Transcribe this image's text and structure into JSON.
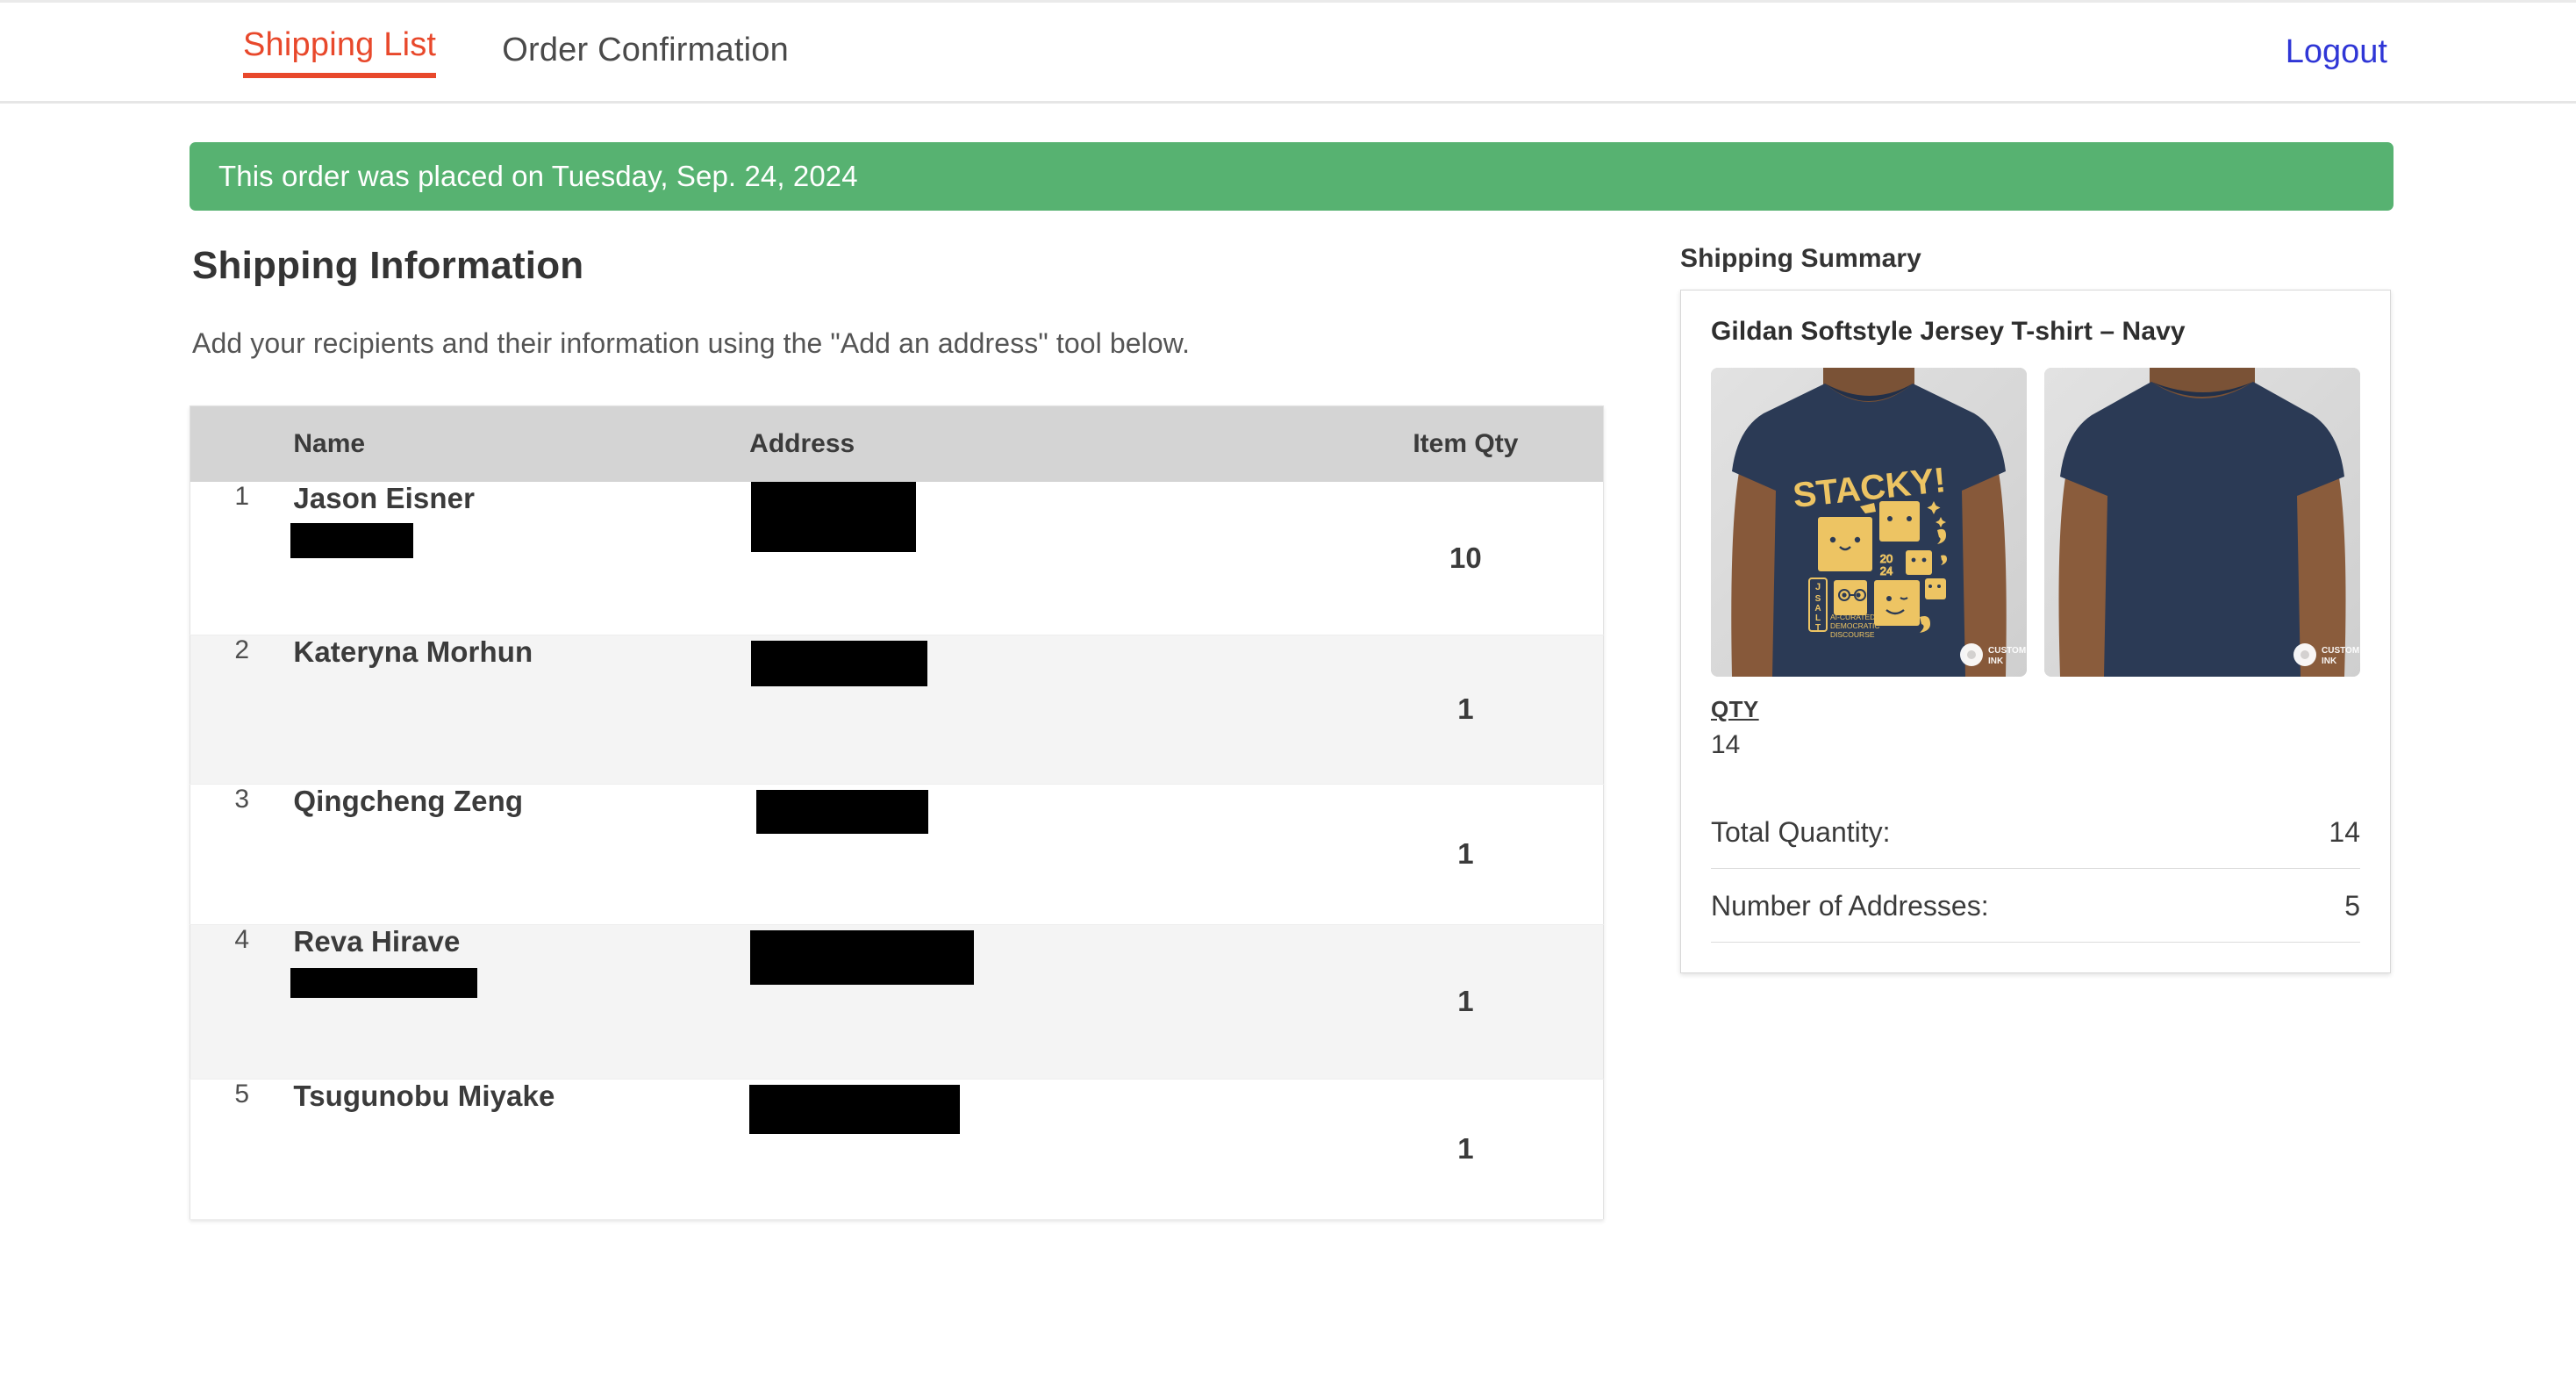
{
  "nav": {
    "tabs": [
      {
        "label": "Shipping List",
        "active": true
      },
      {
        "label": "Order Confirmation",
        "active": false
      }
    ],
    "logout_label": "Logout",
    "active_color": "#e8482b",
    "link_color": "#2f36d6"
  },
  "banner": {
    "text": "This order was placed on Tuesday, Sep. 24, 2024",
    "background_color": "#57b271",
    "text_color": "#ffffff"
  },
  "main": {
    "title": "Shipping Information",
    "subtitle": "Add your recipients and their information using the \"Add an address\" tool below.",
    "table": {
      "columns": [
        "",
        "Name",
        "Address",
        "Item Qty"
      ],
      "header_background": "#d4d4d4",
      "rows": [
        {
          "index": "1",
          "name": "Jason Eisner",
          "name_redacted": true,
          "address_redacted": true,
          "qty": "10"
        },
        {
          "index": "2",
          "name": "Kateryna Morhun",
          "name_redacted": false,
          "address_redacted": true,
          "qty": "1"
        },
        {
          "index": "3",
          "name": "Qingcheng Zeng",
          "name_redacted": false,
          "address_redacted": true,
          "qty": "1"
        },
        {
          "index": "4",
          "name": "Reva Hirave",
          "name_redacted": true,
          "address_redacted": true,
          "qty": "1"
        },
        {
          "index": "5",
          "name": "Tsugunobu Miyake",
          "name_redacted": false,
          "address_redacted": true,
          "qty": "1"
        }
      ]
    }
  },
  "summary": {
    "title": "Shipping Summary",
    "product_name": "Gildan Softstyle Jersey T-shirt – Navy",
    "images": [
      {
        "alt": "tshirt-front-navy-stacky-design",
        "view": "front"
      },
      {
        "alt": "tshirt-back-navy-plain",
        "view": "back"
      }
    ],
    "shirt_design": {
      "headline": "STACKY!",
      "year": "20 24",
      "brand_tag": "J SALT",
      "tagline_line1": "AI-CURATED",
      "tagline_line2": "DEMOCRATIC",
      "tagline_line3": "DISCOURSE",
      "shirt_color": "#2b3a55",
      "print_color": "#edc463",
      "watermark_line1": "CUSTOM",
      "watermark_line2": "INK"
    },
    "qty_label": "QTY",
    "qty_value": "14",
    "totals": [
      {
        "label": "Total Quantity:",
        "value": "14"
      },
      {
        "label": "Number of Addresses:",
        "value": "5"
      }
    ]
  }
}
